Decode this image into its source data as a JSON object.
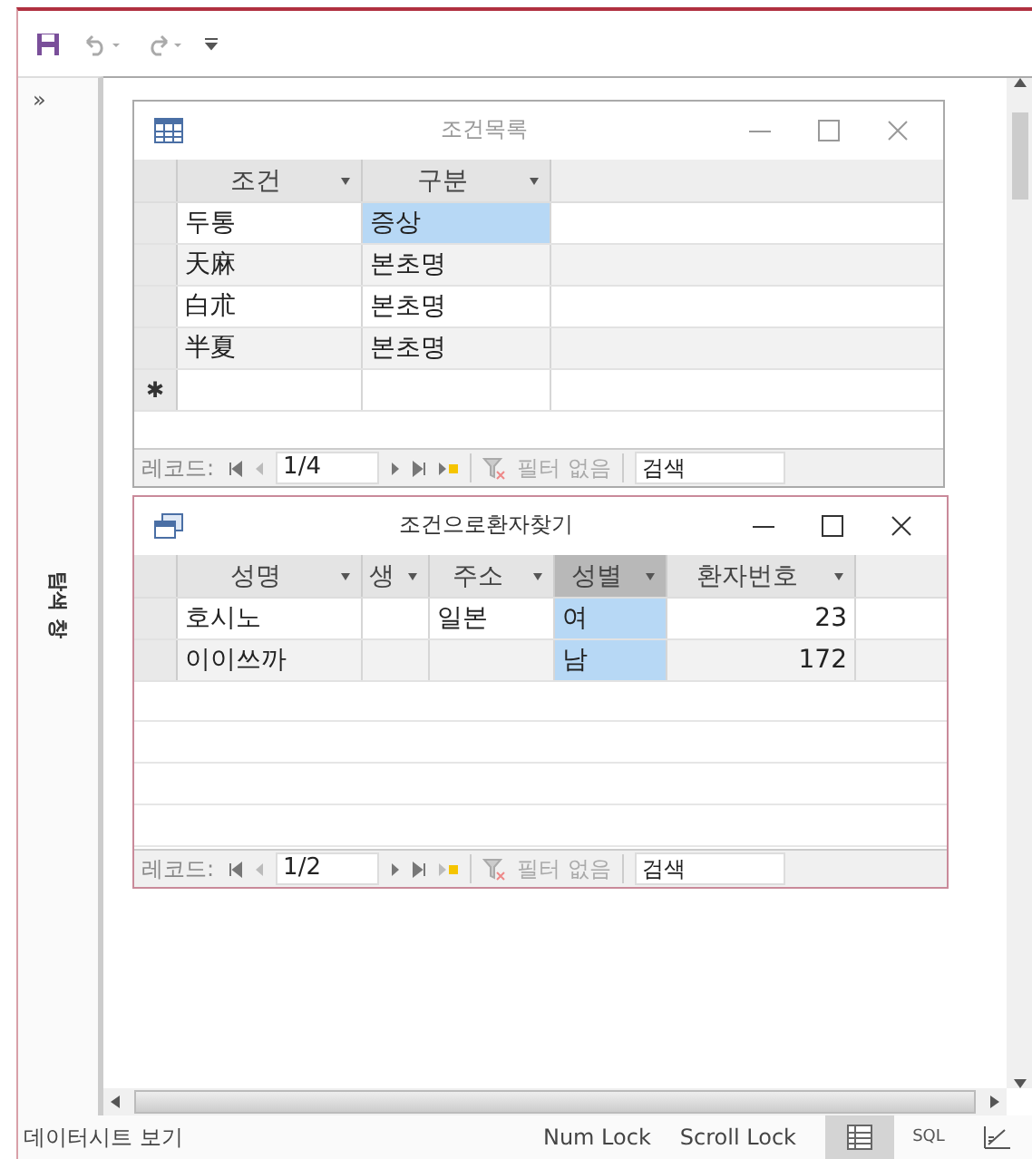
{
  "nav_pane": {
    "toggle": "»",
    "label": "탐색 창"
  },
  "windows": [
    {
      "title": "조건목록",
      "kind": "table",
      "active": false,
      "columns": [
        {
          "label": "조건",
          "selected": false,
          "kind": "text"
        },
        {
          "label": "구분",
          "selected": false,
          "kind": "text"
        }
      ],
      "rows": [
        {
          "cells": [
            {
              "text": "두통",
              "selected": false
            },
            {
              "text": "증상",
              "selected": true
            }
          ]
        },
        {
          "cells": [
            {
              "text": "天麻",
              "selected": false
            },
            {
              "text": "본초명",
              "selected": false
            }
          ]
        },
        {
          "cells": [
            {
              "text": "白朮",
              "selected": false
            },
            {
              "text": "본초명",
              "selected": false
            }
          ]
        },
        {
          "cells": [
            {
              "text": "半夏",
              "selected": false
            },
            {
              "text": "본초명",
              "selected": false
            }
          ]
        }
      ],
      "new_row_marker": "✱",
      "record_nav": {
        "label": "레코드:",
        "position": "1/4",
        "filter": "필터 없음",
        "search": "검색"
      }
    },
    {
      "title": "조건으로환자찾기",
      "kind": "form",
      "active": true,
      "columns": [
        {
          "label": "성명",
          "selected": false,
          "kind": "text"
        },
        {
          "label": "생",
          "selected": false,
          "kind": "text"
        },
        {
          "label": "주소",
          "selected": false,
          "kind": "text"
        },
        {
          "label": "성별",
          "selected": true,
          "kind": "text"
        },
        {
          "label": "환자번호",
          "selected": false,
          "kind": "number"
        }
      ],
      "rows": [
        {
          "cells": [
            {
              "text": "호시노",
              "selected": false
            },
            {
              "text": "",
              "selected": false
            },
            {
              "text": "일본",
              "selected": false
            },
            {
              "text": "여",
              "selected": true
            },
            {
              "text": "23",
              "selected": false
            }
          ]
        },
        {
          "cells": [
            {
              "text": "이이쓰까",
              "selected": false
            },
            {
              "text": "",
              "selected": false
            },
            {
              "text": "",
              "selected": false
            },
            {
              "text": "남",
              "selected": true
            },
            {
              "text": "172",
              "selected": false
            }
          ]
        }
      ],
      "record_nav": {
        "label": "레코드:",
        "position": "1/2",
        "filter": "필터 없음",
        "search": "검색"
      }
    }
  ],
  "status_bar": {
    "text": "데이터시트 보기",
    "indicators": [
      "Num Lock",
      "Scroll Lock"
    ],
    "views": [
      {
        "kind": "datasheet",
        "selected": true
      },
      {
        "kind": "sql",
        "label": "SQL",
        "selected": false
      },
      {
        "kind": "design",
        "selected": false
      }
    ]
  }
}
